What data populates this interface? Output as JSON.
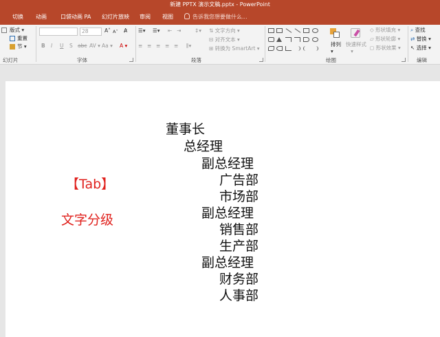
{
  "window": {
    "title": "新建 PPTX 演示文稿.pptx - PowerPoint"
  },
  "tabs": [
    {
      "label": "切换"
    },
    {
      "label": "动画"
    },
    {
      "label": "口袋动画 PA"
    },
    {
      "label": "幻灯片放映"
    },
    {
      "label": "审阅"
    },
    {
      "label": "视图"
    }
  ],
  "tell_me": {
    "placeholder": "告诉我您想要做什么..."
  },
  "ribbon": {
    "clipboard": {
      "label": "幻灯片",
      "layout": "版式",
      "reset": "重置",
      "section": "节"
    },
    "font": {
      "label": "字体",
      "size": "28",
      "grow": "A",
      "shrink": "A"
    },
    "paragraph": {
      "label": "段落",
      "text_direction": "文字方向",
      "align_text": "对齐文本",
      "smartart": "转换为 SmartArt"
    },
    "drawing": {
      "label": "绘图",
      "arrange": "排列",
      "quick_styles": "快速样式",
      "shape_fill": "形状填充",
      "shape_outline": "形状轮廓",
      "shape_effects": "形状效果"
    },
    "editing": {
      "label": "编辑",
      "find": "查找",
      "replace": "替换",
      "select": "选择"
    }
  },
  "slide": {
    "note_tab": "【Tab】",
    "note_text": "文字分级",
    "outline": [
      {
        "text": "董事长",
        "level": 0
      },
      {
        "text": "总经理",
        "level": 1
      },
      {
        "text": "副总经理",
        "level": 2
      },
      {
        "text": "广告部",
        "level": 3
      },
      {
        "text": "市场部",
        "level": 3
      },
      {
        "text": "副总经理",
        "level": 2
      },
      {
        "text": "销售部",
        "level": 3
      },
      {
        "text": "生产部",
        "level": 3
      },
      {
        "text": "副总经理",
        "level": 2
      },
      {
        "text": "财务部",
        "level": 3
      },
      {
        "text": "人事部",
        "level": 3
      }
    ]
  },
  "colors": {
    "accent": "#b7472a",
    "note": "#e0211d"
  },
  "icons": [
    "lightbulb-icon",
    "search-icon",
    "replace-icon",
    "select-cursor-icon"
  ]
}
